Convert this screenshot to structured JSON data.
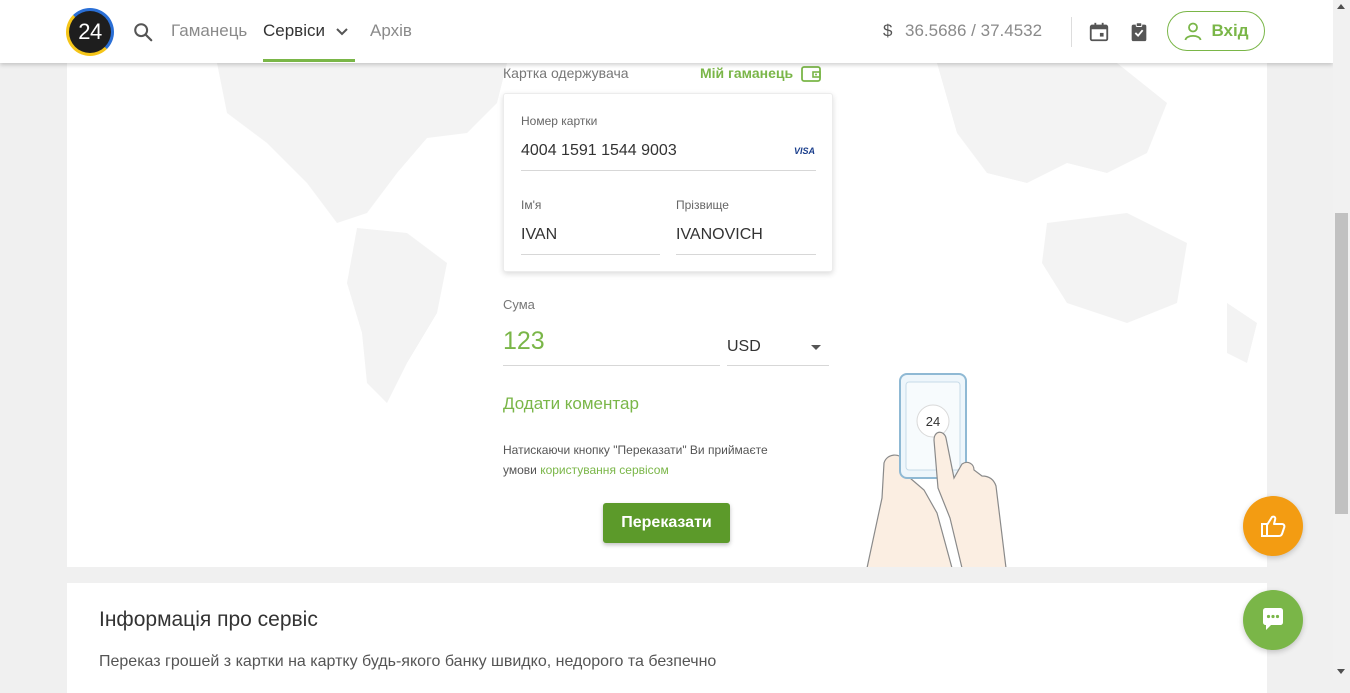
{
  "header": {
    "logo_text": "24",
    "nav": {
      "wallet": "Гаманець",
      "services": "Сервіси",
      "archive": "Архів"
    },
    "rate_symbol": "$",
    "rate": "36.5686 / 37.4532",
    "login_label": "Вхід"
  },
  "form": {
    "recipient_label": "Картка одержувача",
    "my_wallet": "Мій гаманець",
    "card_number_label": "Номер картки",
    "card_number": "4004 1591 1544 9003",
    "card_brand": "VISA",
    "first_name_label": "Ім'я",
    "first_name": "IVAN",
    "last_name_label": "Прізвище",
    "last_name": "IVANOVICH",
    "sum_label": "Сума",
    "sum_value": "123",
    "currency": "USD",
    "add_comment": "Додати коментар",
    "terms_text": "Натискаючи кнопку \"Переказати\" Ви приймаєте умови ",
    "terms_link": "користування сервісом",
    "transfer_button": "Переказати"
  },
  "illustration": {
    "phone_logo": "24"
  },
  "info": {
    "title": "Інформація про сервіс",
    "text": "Переказ грошей з картки на картку будь-якого банку швидко, недорого та безпечно"
  },
  "colors": {
    "accent_green": "#7ab648",
    "button_green": "#5c9a2a",
    "like_orange": "#f39c12"
  }
}
